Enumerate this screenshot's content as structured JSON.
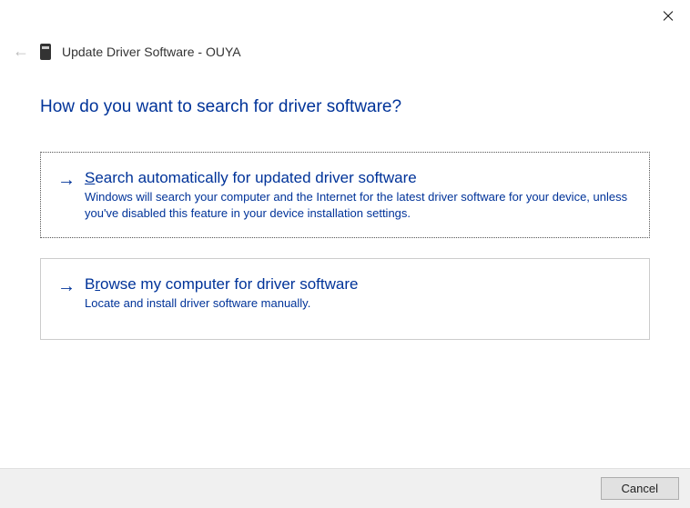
{
  "window": {
    "title": "Update Driver Software - OUYA"
  },
  "heading": "How do you want to search for driver software?",
  "options": [
    {
      "title_pre": "",
      "mnemonic": "S",
      "title_post": "earch automatically for updated driver software",
      "desc": "Windows will search your computer and the Internet for the latest driver software for your device, unless you've disabled this feature in your device installation settings."
    },
    {
      "title_pre": "B",
      "mnemonic": "r",
      "title_post": "owse my computer for driver software",
      "desc": "Locate and install driver software manually."
    }
  ],
  "buttons": {
    "cancel": "Cancel"
  }
}
